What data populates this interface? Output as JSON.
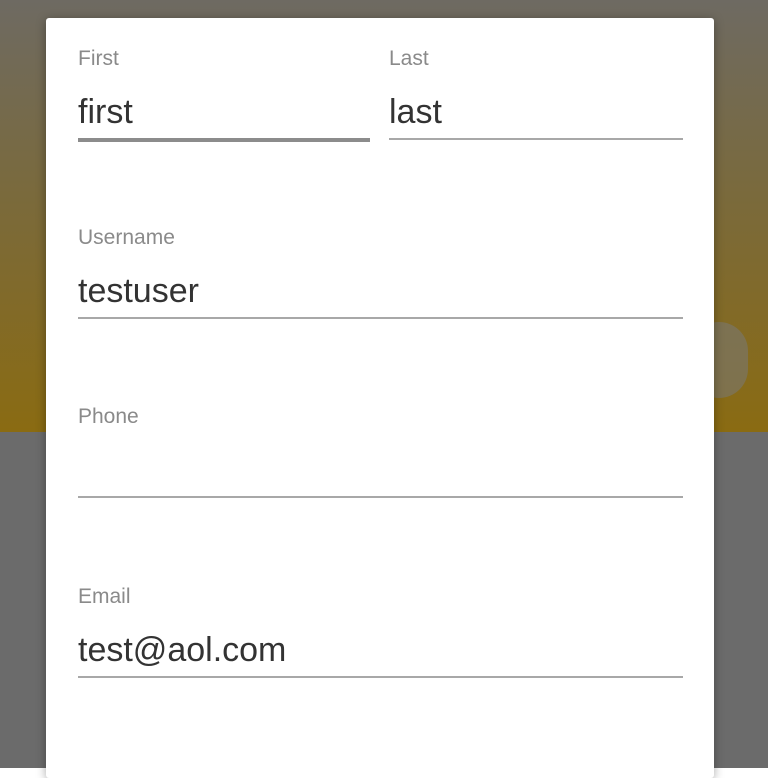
{
  "form": {
    "first": {
      "label": "First",
      "value": "first"
    },
    "last": {
      "label": "Last",
      "value": "last"
    },
    "username": {
      "label": "Username",
      "value": "testuser"
    },
    "phone": {
      "label": "Phone",
      "value": ""
    },
    "email": {
      "label": "Email",
      "value": "test@aol.com"
    }
  },
  "carousel": {
    "next_icon": "chevron-right-icon"
  },
  "colors": {
    "backdrop_accent": "#8a6b12",
    "backdrop": "#6b6b6b",
    "dialog": "#ffffff"
  }
}
